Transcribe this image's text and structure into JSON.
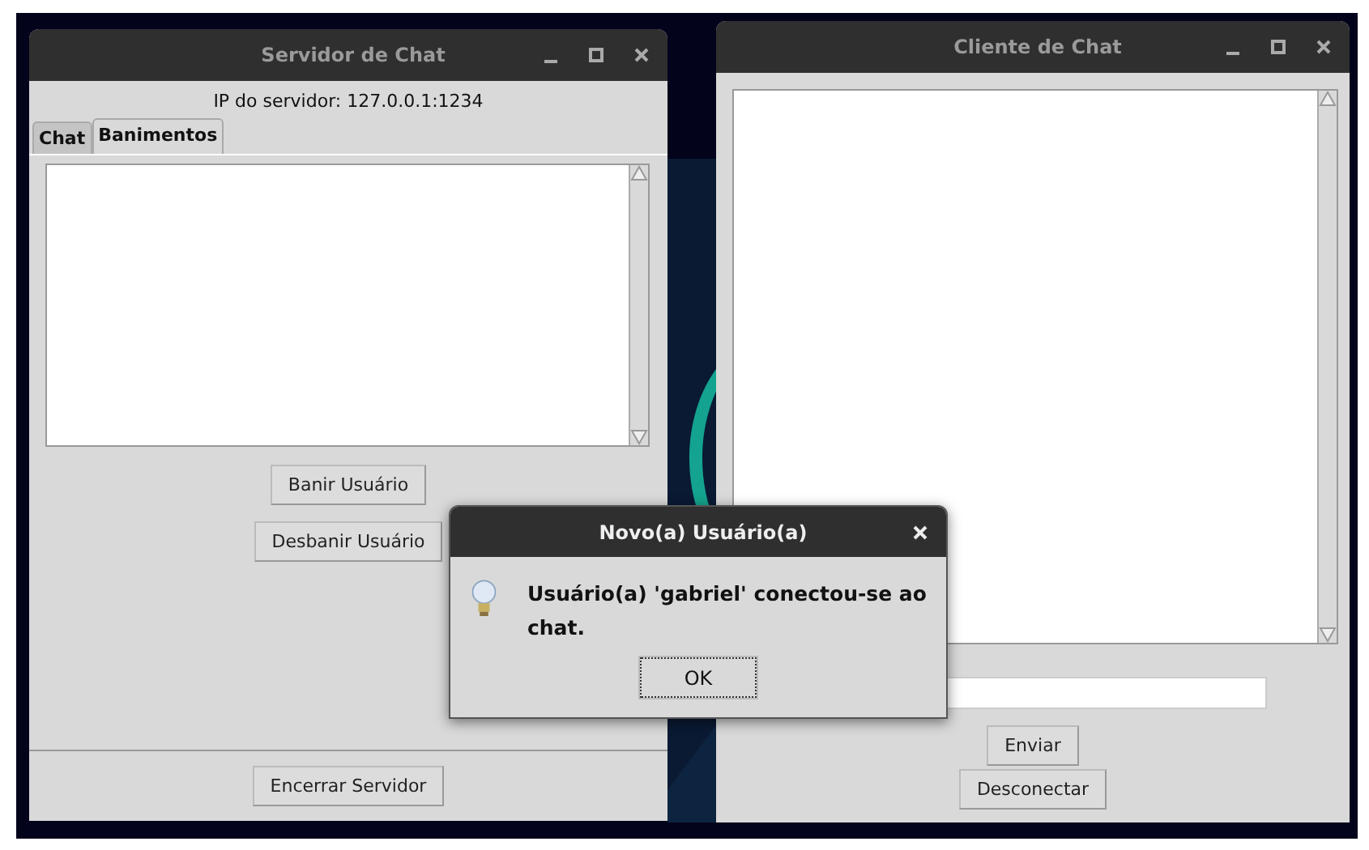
{
  "server_window": {
    "title": "Servidor de Chat",
    "server_ip": "IP do servidor: 127.0.0.1:1234",
    "tabs": [
      {
        "label": "Chat",
        "selected": false
      },
      {
        "label": "Banimentos",
        "selected": true
      }
    ],
    "buttons": [
      "Banir Usuário",
      "Desbanir Usuário"
    ],
    "footer_button": "Encerrar Servidor"
  },
  "client_window": {
    "title": "Cliente de Chat",
    "buttons": [
      "Enviar",
      "Desconectar"
    ]
  },
  "dialog": {
    "title": "Novo(a) Usuário(a)",
    "message": "Usuário(a) 'gabriel' conectou-se ao chat.",
    "button": "OK"
  }
}
